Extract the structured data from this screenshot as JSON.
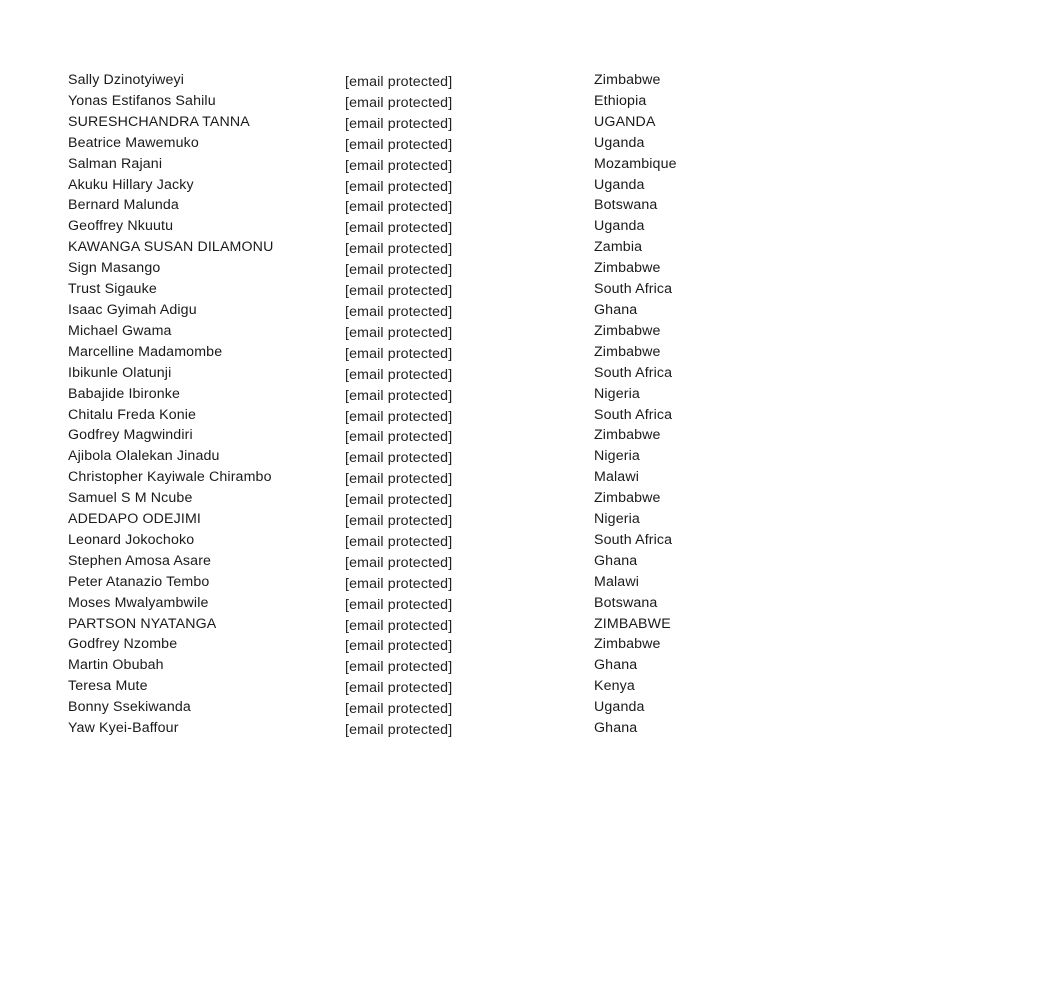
{
  "document": {
    "type": "plain-text-table",
    "columns": [
      "name",
      "email",
      "country"
    ],
    "row_count": 32,
    "background_color": "#ffffff",
    "text_color": "#1a1a1a",
    "email_placeholder": "[email protected]"
  },
  "rows": [
    {
      "name": "Sally Dzinotyiweyi",
      "email": "[email protected]",
      "country": "Zimbabwe"
    },
    {
      "name": "Yonas Estifanos Sahilu",
      "email": "[email protected]",
      "country": "Ethiopia"
    },
    {
      "name": "SURESHCHANDRA TANNA",
      "email": "[email protected]",
      "country": "UGANDA"
    },
    {
      "name": "Beatrice Mawemuko",
      "email": "[email protected]",
      "country": "Uganda"
    },
    {
      "name": "Salman Rajani",
      "email": "[email protected]",
      "country": "Mozambique"
    },
    {
      "name": "Akuku Hillary Jacky",
      "email": "[email protected]",
      "country": "Uganda"
    },
    {
      "name": "Bernard Malunda",
      "email": "[email protected]",
      "country": "Botswana"
    },
    {
      "name": "Geoffrey Nkuutu",
      "email": "[email protected]",
      "country": "Uganda"
    },
    {
      "name": "KAWANGA SUSAN DILAMONU",
      "email": "[email protected]",
      "country": "Zambia"
    },
    {
      "name": "Sign Masango",
      "email": "[email protected]",
      "country": "Zimbabwe"
    },
    {
      "name": "Trust Sigauke",
      "email": "[email protected]",
      "country": "South Africa"
    },
    {
      "name": "Isaac Gyimah Adigu",
      "email": "[email protected]",
      "country": "Ghana"
    },
    {
      "name": "Michael Gwama",
      "email": "[email protected]",
      "country": "Zimbabwe"
    },
    {
      "name": "Marcelline Madamombe",
      "email": "[email protected]",
      "country": "Zimbabwe"
    },
    {
      "name": "Ibikunle Olatunji",
      "email": "[email protected]",
      "country": "South Africa"
    },
    {
      "name": "Babajide Ibironke",
      "email": "[email protected]",
      "country": "Nigeria"
    },
    {
      "name": "Chitalu Freda Konie",
      "email": "[email protected]",
      "country": "South Africa"
    },
    {
      "name": "Godfrey Magwindiri",
      "email": "[email protected]",
      "country": "Zimbabwe"
    },
    {
      "name": "Ajibola Olalekan Jinadu",
      "email": "[email protected]",
      "country": "Nigeria"
    },
    {
      "name": "Christopher Kayiwale Chirambo",
      "email": "[email protected]",
      "country": "Malawi"
    },
    {
      "name": "Samuel S M Ncube",
      "email": "[email protected]",
      "country": "Zimbabwe"
    },
    {
      "name": "ADEDAPO ODEJIMI",
      "email": "[email protected]",
      "country": "Nigeria"
    },
    {
      "name": "Leonard Jokochoko",
      "email": "[email protected]",
      "country": "South Africa"
    },
    {
      "name": "Stephen Amosa Asare",
      "email": "[email protected]",
      "country": "Ghana"
    },
    {
      "name": "Peter Atanazio Tembo",
      "email": "[email protected]",
      "country": "Malawi"
    },
    {
      "name": "Moses Mwalyambwile",
      "email": "[email protected]",
      "country": "Botswana"
    },
    {
      "name": "PARTSON NYATANGA",
      "email": "[email protected]",
      "country": "ZIMBABWE"
    },
    {
      "name": "Godfrey Nzombe",
      "email": "[email protected]",
      "country": "Zimbabwe"
    },
    {
      "name": "Martin Obubah",
      "email": "[email protected]",
      "country": "Ghana"
    },
    {
      "name": "Teresa Mute",
      "email": "[email protected]",
      "country": "Kenya"
    },
    {
      "name": "Bonny Ssekiwanda",
      "email": "[email protected]",
      "country": "Uganda"
    },
    {
      "name": "Yaw Kyei-Baffour",
      "email": "[email protected]",
      "country": "Ghana"
    }
  ]
}
